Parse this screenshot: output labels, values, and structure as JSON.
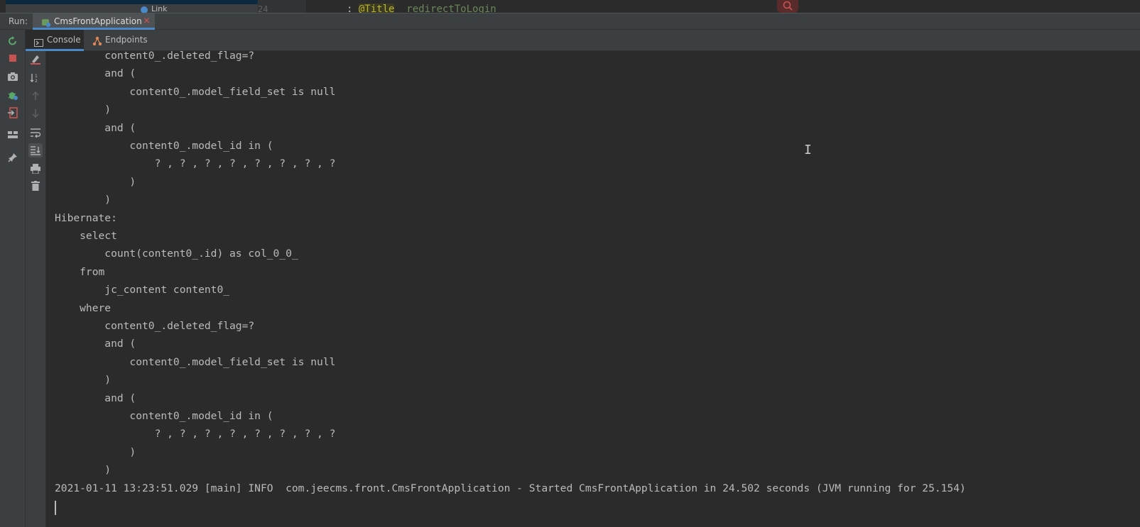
{
  "editor": {
    "line_number": "24",
    "tree_item_label": "Link",
    "code_annotation": "@Title",
    "code_string": "redirectToLogin"
  },
  "run_header": {
    "label": "Run:",
    "tab_label": "CmsFrontApplication",
    "close_glyph": "×"
  },
  "console_tabs": [
    {
      "label": "Console"
    },
    {
      "label": "Endpoints"
    }
  ],
  "console": {
    "lines": [
      "        content0_.deleted_flag=?",
      "        and (",
      "            content0_.model_field_set is null",
      "        )",
      "        and (",
      "            content0_.model_id in (",
      "                ? , ? , ? , ? , ? , ? , ? , ?",
      "            )",
      "        )",
      "Hibernate: ",
      "    select",
      "        count(content0_.id) as col_0_0_ ",
      "    from",
      "        jc_content content0_ ",
      "    where",
      "        content0_.deleted_flag=?",
      "        and (",
      "            content0_.model_field_set is null",
      "        )",
      "        and (",
      "            content0_.model_id in (",
      "                ? , ? , ? , ? , ? , ? , ? , ?",
      "            )",
      "        )",
      "2021-01-11 13:23:51.029 [main] INFO  com.jeecms.front.CmsFrontApplication - Started CmsFrontApplication in 24.502 seconds (JVM running for 25.154)"
    ]
  },
  "colors": {
    "background": "#2b2b2b",
    "panel": "#3c3f41",
    "accent": "#4a88c7",
    "text": "#bbbbbb",
    "stop_red": "#c75450",
    "run_green": "#59a869"
  }
}
